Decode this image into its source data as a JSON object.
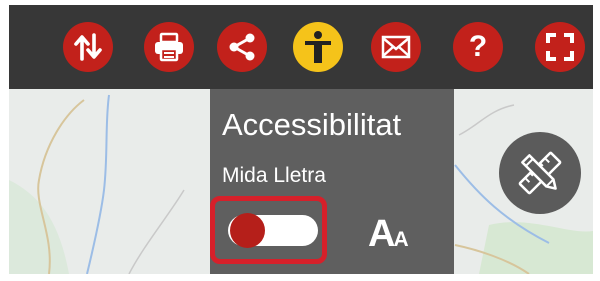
{
  "toolbar": {
    "buttons": [
      {
        "icon": "swap-vertical-icon",
        "label": ""
      },
      {
        "icon": "print-icon",
        "label": ""
      },
      {
        "icon": "share-icon",
        "label": ""
      },
      {
        "icon": "accessibility-icon",
        "label": "",
        "active": true
      },
      {
        "icon": "mail-icon",
        "label": ""
      },
      {
        "icon": "help-icon",
        "label": "?"
      },
      {
        "icon": "fullscreen-icon",
        "label": ""
      }
    ],
    "colors": {
      "background": "#373737",
      "button": "#c2211b",
      "active_button": "#f5c31a"
    }
  },
  "accessibility_panel": {
    "title": "Accessibilitat",
    "subtitle": "Mida Lletra",
    "font_size_toggle_on": false,
    "font_icon": {
      "large": "A",
      "small": "A"
    },
    "highlight_color": "#d6202a"
  },
  "map": {
    "drawing_tool_icon": "ruler-pencil-icon"
  }
}
